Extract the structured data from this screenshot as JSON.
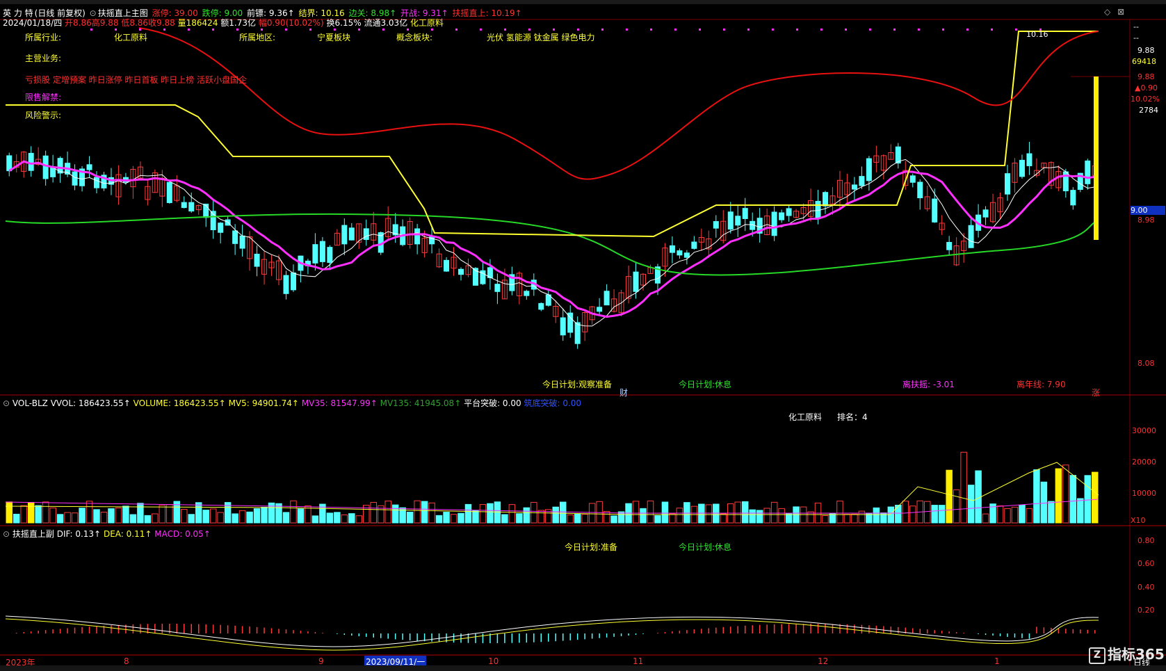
{
  "header": {
    "stock_name": "英 力 特",
    "period": "(日线 前复权)",
    "indicator": "扶摇直上主图",
    "limit_up": "涨停: 39.00",
    "limit_down": "跌停: 9.00",
    "prev": "前镖: 9.36↑",
    "jiejie": "结界: 10.16",
    "bianguan": "边关: 8.98↑",
    "kaizhan": "开战: 9.31↑",
    "fuyao": "扶摇直上: 10.19↑"
  },
  "quote": {
    "date": "2024/01/18/四",
    "open": "开8.86",
    "high": "高9.88",
    "low": "低8.86",
    "close": "收9.88",
    "vol": "量186424",
    "amount": "额1.73亿",
    "change": "幅0.90(10.02%)",
    "turnover": "换6.15%",
    "float": "流通3.03亿",
    "sector": "化工原料"
  },
  "info": {
    "industry_label": "所属行业:",
    "industry": "化工原料",
    "region_label": "所属地区:",
    "region": "宁夏板块",
    "concept_label": "概念板块:",
    "concept": "光伏 氢能源 钛金属 绿色电力",
    "business_label": "主营业务:",
    "tags": "亏损股 定增预案 昨日涨停 昨日首板 昨日上榜 活跃小盘国企",
    "unlock_label": "限售解禁:",
    "risk_label": "风险警示:"
  },
  "main_annot": {
    "plan1": "今日计划:观察准备",
    "plan2": "今日计划:休息",
    "cai": "财",
    "fuyao_lead": "离扶摇: -3.01",
    "niannian": "离年线: 7.90",
    "zhang": "涨",
    "peak": "10.16"
  },
  "right_axis": {
    "dash1": "--",
    "dash2": "--",
    "p1": "9.88",
    "p2": "69418",
    "p3": "9.88",
    "p4": "▲0.90",
    "p5": "10.02%",
    "p6": "2784",
    "cur": "9.00",
    "p7": "8.98",
    "p8": "8.08"
  },
  "vol_panel": {
    "name": "VOL-BLZ",
    "vvol": "VVOL: 186423.55↑",
    "volume": "VOLUME: 186423.55↑",
    "mv5": "MV5: 94901.74↑",
    "mv35": "MV35: 81547.99↑",
    "mv135": "MV135: 41945.08↑",
    "platform": "平台突破: 0.00",
    "bottom": "筑底突破: 0.00",
    "sector": "化工原料",
    "rank": "排名：4",
    "ax1": "30000",
    "ax2": "20000",
    "ax3": "10000",
    "ax4": "X10"
  },
  "macd_panel": {
    "name": "扶摇直上副",
    "dif": "DIF: 0.13↑",
    "dea": "DEA: 0.11↑",
    "macd": "MACD: 0.05↑",
    "plan1": "今日计划:准备",
    "plan2": "今日计划:休息",
    "ax1": "0.80",
    "ax2": "0.60",
    "ax3": "0.40",
    "ax4": "0.20"
  },
  "timeline": {
    "t0": "2023年",
    "t1": "8",
    "t2": "9",
    "t3": "2023/09/11/一",
    "t4": "10",
    "t5": "11",
    "t6": "12",
    "t7": "1",
    "period": "日线"
  },
  "logo": {
    "text": "指标365",
    "mark": "Z"
  },
  "colors": {
    "up": "#ff3b3b",
    "down": "#54ffff",
    "ma_white": "#ffffff",
    "ma_magenta": "#ff30ff",
    "ma_green": "#27d927",
    "ma_yellow": "#ffff30",
    "ma_red": "#e81010"
  }
}
